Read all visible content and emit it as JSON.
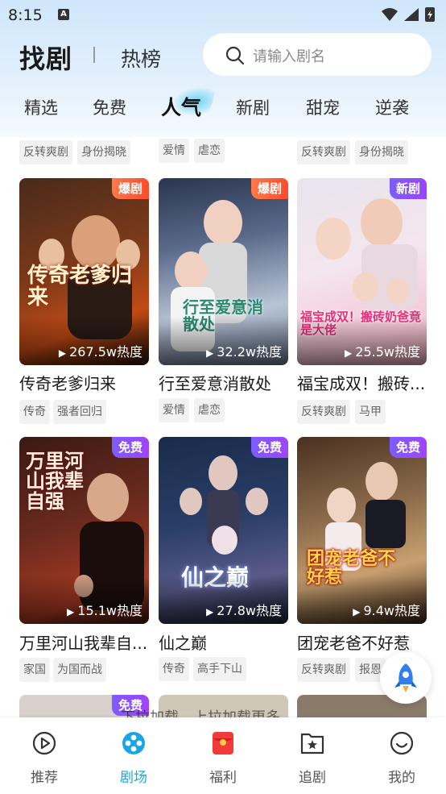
{
  "status_bar": {
    "time": "8:15",
    "notification_letter": "A"
  },
  "header": {
    "title": "找剧",
    "hot_tab": "热榜",
    "search_placeholder": "请输入剧名"
  },
  "tabs": [
    "精选",
    "免费",
    "人气",
    "新剧",
    "甜宠",
    "逆袭"
  ],
  "active_tab": "人气",
  "top_partial_tags": [
    [
      "反转爽剧",
      "身份揭晓"
    ],
    [
      "爱情",
      "虐恋"
    ],
    [
      "反转爽剧",
      "身份揭晓"
    ]
  ],
  "cards": [
    {
      "badge": "爆剧",
      "heat": "267.5w热度",
      "title": "传奇老爹归来",
      "tags": [
        "传奇",
        "强者回归"
      ],
      "poster_text": "传奇老爹归来"
    },
    {
      "badge": "爆剧",
      "heat": "32.2w热度",
      "title": "行至爱意消散处",
      "tags": [
        "爱情",
        "虐恋"
      ],
      "poster_text": "行至爱意消散处"
    },
    {
      "badge": "新剧",
      "heat": "25.5w热度",
      "title": "福宝成双！搬砖...",
      "tags": [
        "反转爽剧",
        "马甲"
      ],
      "poster_text": "福宝成双！搬砖奶爸竟是大佬"
    },
    {
      "badge": "免费",
      "heat": "15.1w热度",
      "title": "万里河山我辈自...",
      "tags": [
        "家国",
        "为国而战"
      ],
      "poster_text": "万里河山我辈自强"
    },
    {
      "badge": "免费",
      "heat": "27.8w热度",
      "title": "仙之巅",
      "tags": [
        "传奇",
        "高手下山"
      ],
      "poster_text": "仙之巅"
    },
    {
      "badge": "免费",
      "heat": "9.4w热度",
      "title": "团宠老爸不好惹",
      "tags": [
        "反转爽剧",
        "报恩"
      ],
      "poster_text": "团宠老爸不好惹"
    }
  ],
  "partial_badge": "免费",
  "toast_text": "下拉加载，上拉加载更多",
  "bottom_nav": [
    {
      "label": "推荐",
      "icon": "play-circle-icon"
    },
    {
      "label": "剧场",
      "icon": "theater-icon"
    },
    {
      "label": "福利",
      "icon": "red-envelope-icon"
    },
    {
      "label": "追剧",
      "icon": "bookmark-folder-icon"
    },
    {
      "label": "我的",
      "icon": "smile-face-icon"
    }
  ],
  "active_nav": "剧场",
  "colors": {
    "accent": "#1aa5e6",
    "hot_badge": "#ff4b2b",
    "new_badge": "#8a4cff"
  }
}
